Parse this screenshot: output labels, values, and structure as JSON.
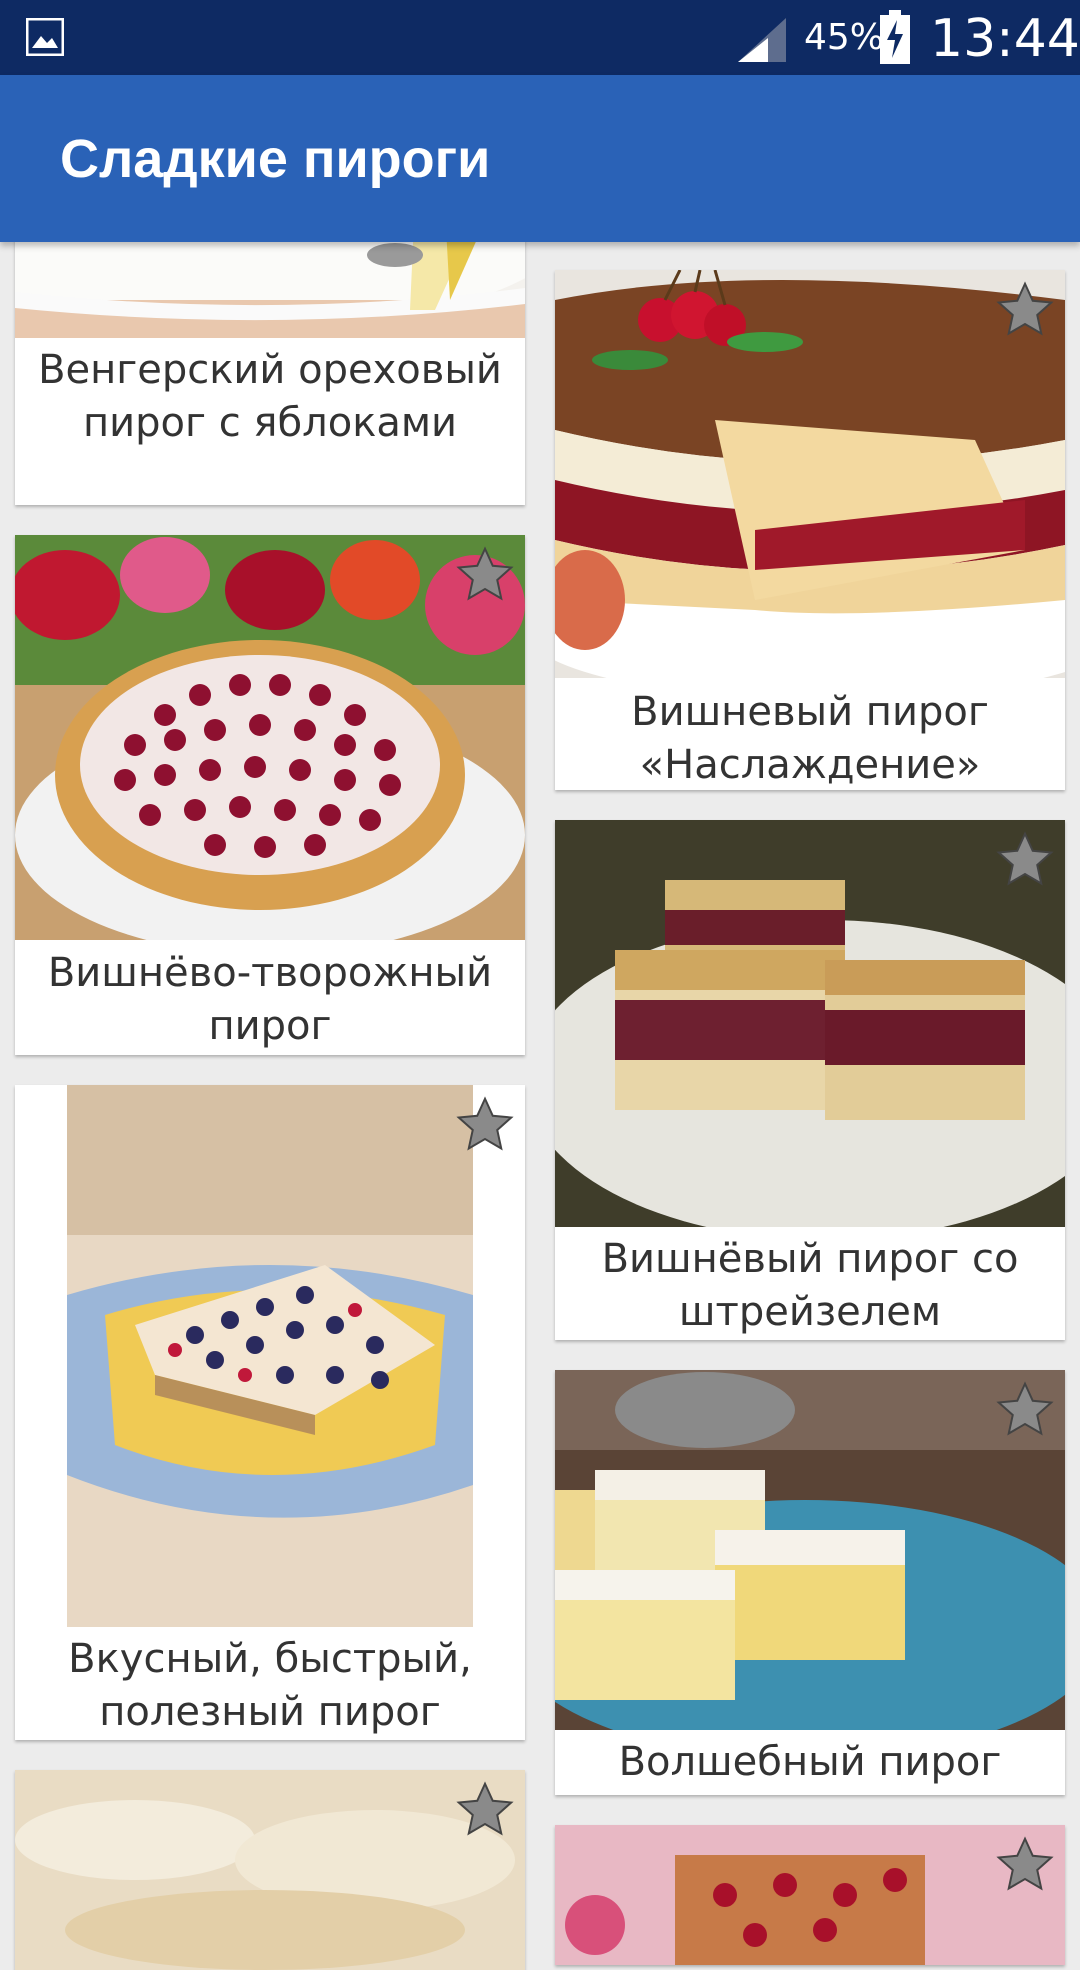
{
  "status_bar": {
    "battery_percent": "45%",
    "time": "13:44",
    "icons": [
      "gallery-icon",
      "signal-icon",
      "battery-charging-icon"
    ]
  },
  "app_bar": {
    "title": "Сладкие пироги"
  },
  "recipes": [
    {
      "title": "Венгерский ореховый пирог с яблоками",
      "favorite": false
    },
    {
      "title": "Вишневый пирог «Наслаждение»",
      "favorite": false
    },
    {
      "title": "Вишнёво-творожный пирог",
      "favorite": false
    },
    {
      "title": "Вишнёвый пирог со штрейзелем",
      "favorite": false
    },
    {
      "title": "Вкусный, быстрый, полезный пирог",
      "favorite": false
    },
    {
      "title": "Волшебный пирог",
      "favorite": false
    }
  ],
  "colors": {
    "status_bar": "#0e2a63",
    "app_bar": "#2a62b7",
    "background": "#ececec",
    "star": "#888888"
  }
}
